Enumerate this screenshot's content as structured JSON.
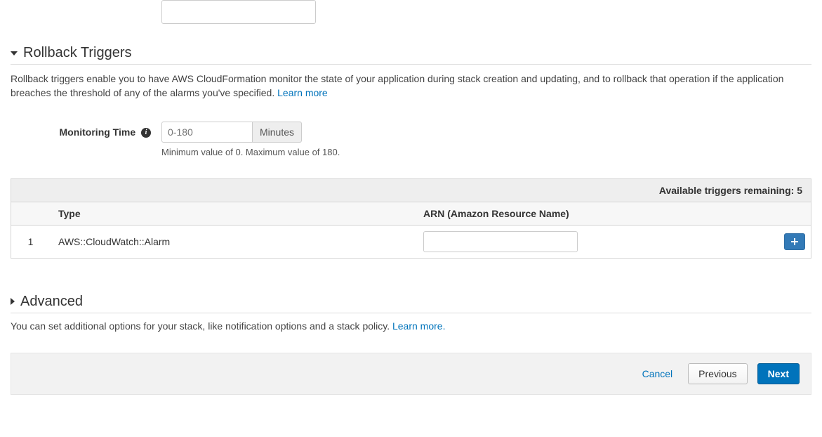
{
  "rollback": {
    "title": "Rollback Triggers",
    "description": "Rollback triggers enable you to have AWS CloudFormation monitor the state of your application during stack creation and updating, and to rollback that operation if the application breaches the threshold of any of the alarms you've specified. ",
    "learn_more": "Learn more",
    "monitoring": {
      "label": "Monitoring Time",
      "placeholder": "0-180",
      "unit": "Minutes",
      "help": "Minimum value of 0. Maximum value of 180."
    },
    "table": {
      "remaining_label": "Available triggers remaining: ",
      "remaining_value": "5",
      "head_type": "Type",
      "head_arn": "ARN (Amazon Resource Name)",
      "rows": [
        {
          "index": "1",
          "type": "AWS::CloudWatch::Alarm",
          "arn": ""
        }
      ]
    }
  },
  "advanced": {
    "title": "Advanced",
    "description": "You can set additional options for your stack, like notification options and a stack policy. ",
    "learn_more": "Learn more."
  },
  "footer": {
    "cancel": "Cancel",
    "previous": "Previous",
    "next": "Next"
  }
}
